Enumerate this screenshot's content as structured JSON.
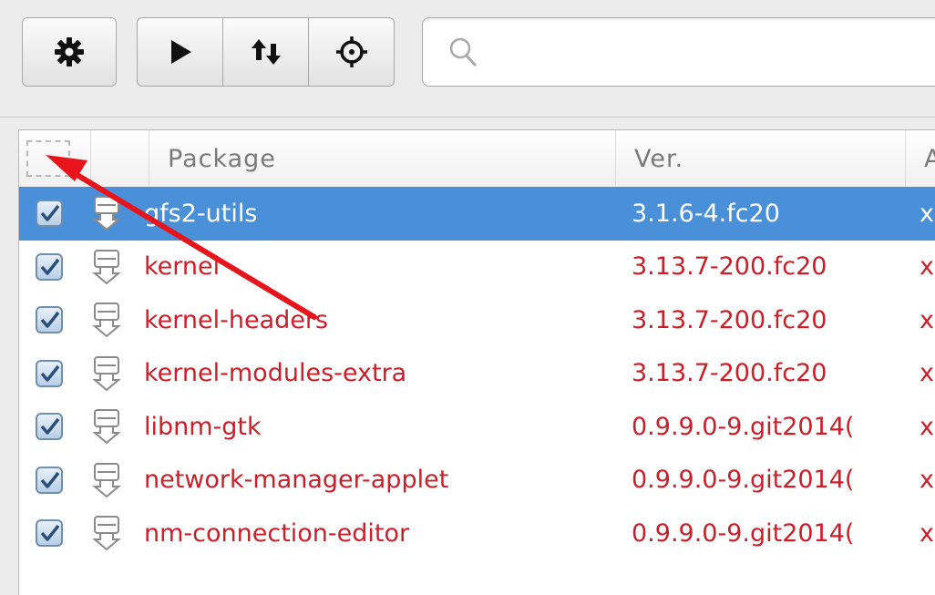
{
  "toolbar": {
    "buttons": [
      {
        "icon": "gear-icon"
      },
      {
        "icon": "play-icon"
      },
      {
        "icon": "up-down-arrows-icon"
      },
      {
        "icon": "crosshair-icon"
      }
    ],
    "search": {
      "value": "",
      "placeholder": ""
    }
  },
  "table": {
    "columns": [
      "Package",
      "Ver.",
      "A"
    ],
    "rows": [
      {
        "checked": true,
        "package": "gfs2-utils",
        "version": "3.1.6-4.fc20",
        "arch": "x",
        "selected": true
      },
      {
        "checked": true,
        "package": "kernel",
        "version": "3.13.7-200.fc20",
        "arch": "x"
      },
      {
        "checked": true,
        "package": "kernel-headers",
        "version": "3.13.7-200.fc20",
        "arch": "x"
      },
      {
        "checked": true,
        "package": "kernel-modules-extra",
        "version": "3.13.7-200.fc20",
        "arch": "x"
      },
      {
        "checked": true,
        "package": "libnm-gtk",
        "version": "0.9.9.0-9.git2014(",
        "arch": "x"
      },
      {
        "checked": true,
        "package": "network-manager-applet",
        "version": "0.9.9.0-9.git2014(",
        "arch": "x"
      },
      {
        "checked": true,
        "package": "nm-connection-editor",
        "version": "0.9.9.0-9.git2014(",
        "arch": "x"
      }
    ]
  },
  "colors": {
    "selection": "#4a90d9",
    "update_text": "#c8202a",
    "annotation_arrow": "#e8141c"
  }
}
